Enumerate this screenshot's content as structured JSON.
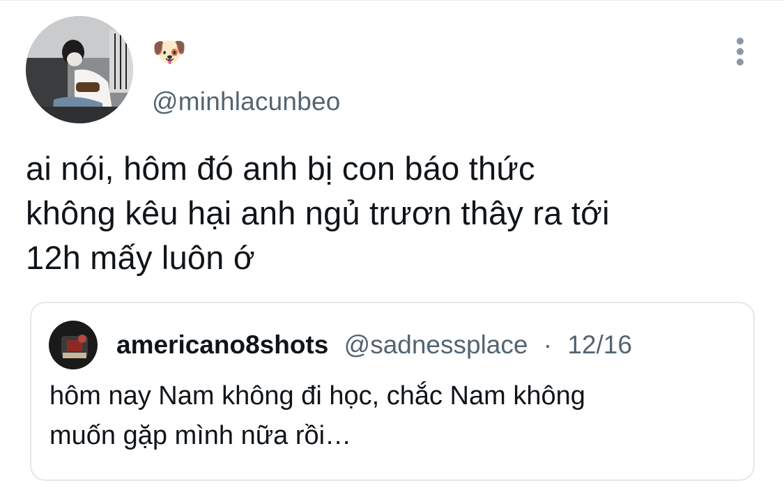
{
  "tweet": {
    "display_name": "🐶",
    "handle": "@minhlacunbeo",
    "text_lines": [
      "ai nói, hôm đó anh bị con báo thức",
      "không kêu hại anh ngủ trươn thây ra tới",
      "12h mấy luôn ớ"
    ],
    "more_icon": "more-vertical-icon"
  },
  "quote": {
    "name": "americano8shots",
    "handle": "@sadnessplace",
    "separator": "·",
    "date": "12/16",
    "text_lines": [
      "hôm nay Nam không đi học, chắc Nam không",
      "muốn gặp mình nữa rồi…"
    ]
  },
  "colors": {
    "text_primary": "#0f1419",
    "text_secondary": "#536471",
    "border": "#e1e8ed"
  }
}
